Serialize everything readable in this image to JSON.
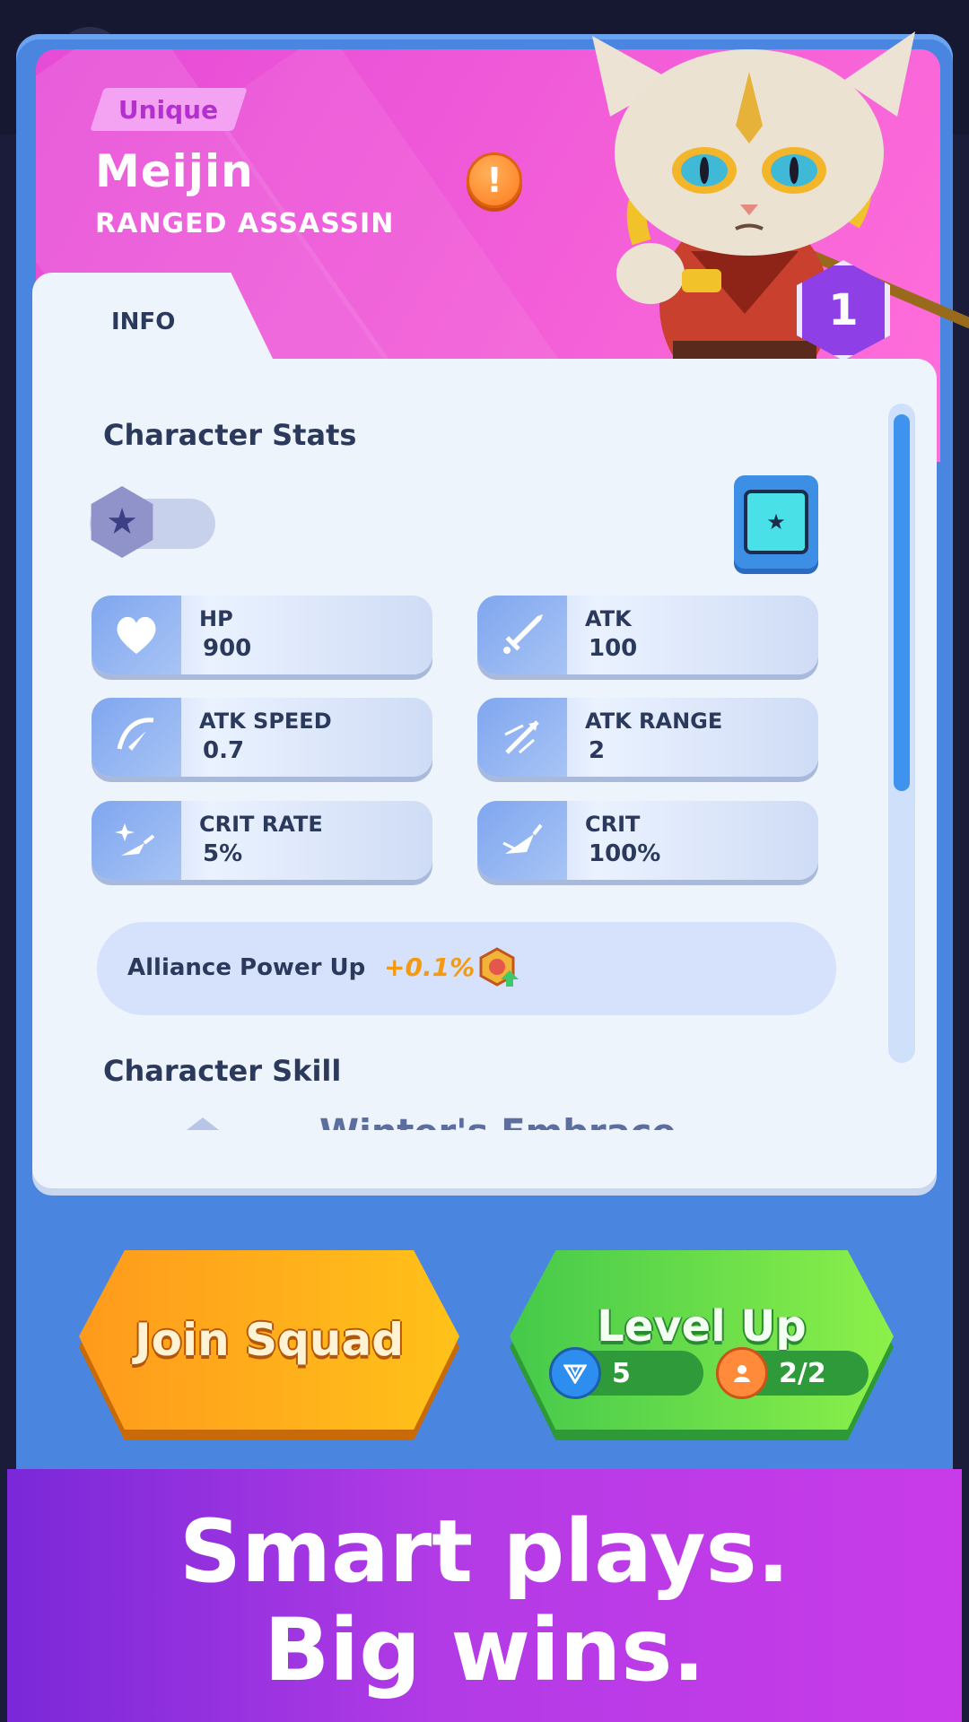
{
  "character": {
    "rarity": "Unique",
    "name": "Meijin",
    "class": "RANGED  ASSASSIN",
    "level": "1"
  },
  "tabs": {
    "info": "INFO"
  },
  "stats_section": {
    "title": "Character Stats",
    "stats": [
      {
        "label": "HP",
        "value": "900",
        "icon": "heart-icon"
      },
      {
        "label": "ATK",
        "value": "100",
        "icon": "sword-icon"
      },
      {
        "label": "ATK SPEED",
        "value": "0.7",
        "icon": "speed-slash-icon"
      },
      {
        "label": "ATK RANGE",
        "value": "2",
        "icon": "range-arrows-icon"
      },
      {
        "label": "CRIT RATE",
        "value": "5%",
        "icon": "crit-rate-icon"
      },
      {
        "label": "CRIT",
        "value": "100%",
        "icon": "crit-damage-icon"
      }
    ]
  },
  "alliance": {
    "text": "Alliance Power Up",
    "bonus": "+0.1%",
    "icon": "alliance-upgrade-icon"
  },
  "skill_section": {
    "title": "Character Skill",
    "skill_name_peek": "Winter's Embrace"
  },
  "buttons": {
    "join_squad": "Join Squad",
    "level_up": "Level Up",
    "gem_cost": "5",
    "medal_cost": "2/2"
  },
  "banner": {
    "line1": "Smart plays.",
    "line2": "Big wins."
  },
  "colors": {
    "header": "#f05ad8",
    "frame": "#4a86e0",
    "join": "#ffb21a",
    "level": "#5fd84a",
    "banner": "#b23be6"
  }
}
